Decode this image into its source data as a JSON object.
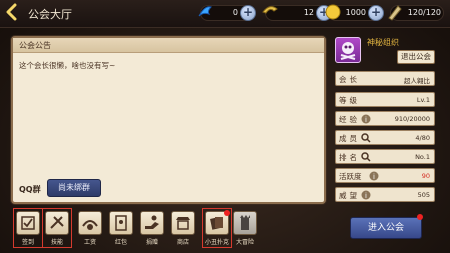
{
  "header": {
    "title": "公会大厅"
  },
  "resources": [
    {
      "icon": "energy-icon",
      "value": "0"
    },
    {
      "icon": "horn-icon",
      "value": "12"
    },
    {
      "icon": "gold-coin-icon",
      "value": "1000"
    },
    {
      "icon": "stamina-icon",
      "value": "120/120"
    }
  ],
  "notice": {
    "title": "公会公告",
    "text": "这个会长很懒，啥也没有写~",
    "qq_label": "QQ群",
    "bind_button": "尚未绑群"
  },
  "guild": {
    "name": "神秘组织",
    "exit_button": "退出公会",
    "rows": [
      {
        "label": "会长",
        "value": "超人翱比"
      },
      {
        "label": "等级",
        "value": "Lv.1"
      },
      {
        "label": "经验",
        "value": "910/20000"
      },
      {
        "label": "成员",
        "value": "4/80"
      },
      {
        "label": "排名",
        "value": "No.1"
      },
      {
        "label": "活跃度",
        "value": "90"
      },
      {
        "label": "威望",
        "value": "505"
      }
    ]
  },
  "bottom_menu": [
    {
      "label": "签到"
    },
    {
      "label": "技能"
    },
    {
      "label": "工资"
    },
    {
      "label": "红包"
    },
    {
      "label": "捐赠"
    },
    {
      "label": "商店"
    },
    {
      "label": "小丑扑克"
    },
    {
      "label": "大冒险"
    }
  ],
  "enter_button": "进入公会",
  "colors": {
    "accent_red": "#d42a20",
    "button_blue": "#37488a",
    "gold_text": "#e6b842"
  }
}
